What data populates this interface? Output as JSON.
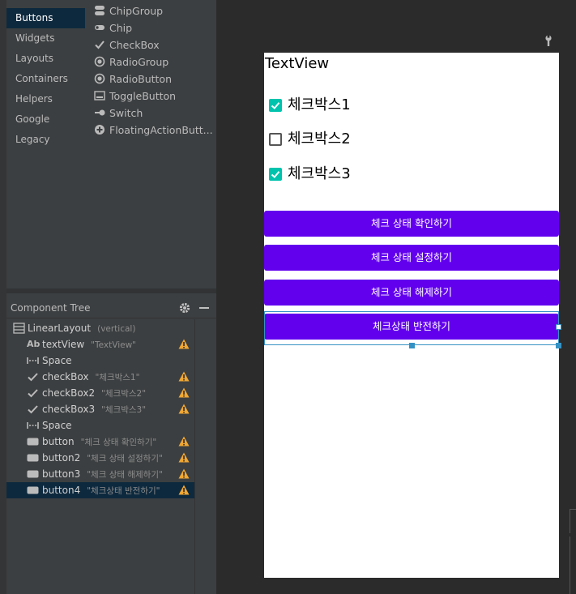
{
  "palette": {
    "categories": [
      "Buttons",
      "Widgets",
      "Layouts",
      "Containers",
      "Helpers",
      "Google",
      "Legacy"
    ],
    "selected_category": "Buttons",
    "items": [
      {
        "label": "ChipGroup",
        "icon": "chip-group-icon"
      },
      {
        "label": "Chip",
        "icon": "chip-icon"
      },
      {
        "label": "CheckBox",
        "icon": "checkmark-icon"
      },
      {
        "label": "RadioGroup",
        "icon": "radio-group-icon"
      },
      {
        "label": "RadioButton",
        "icon": "radio-button-icon"
      },
      {
        "label": "ToggleButton",
        "icon": "toggle-button-icon"
      },
      {
        "label": "Switch",
        "icon": "switch-icon"
      },
      {
        "label": "FloatingActionButt...",
        "icon": "fab-plus-icon"
      }
    ]
  },
  "component_tree": {
    "title": "Component Tree",
    "rows": [
      {
        "name": "LinearLayout",
        "detail": "(vertical)",
        "icon": "linear-layout-icon",
        "indent": 0,
        "warning": false
      },
      {
        "name": "textView",
        "detail": "\"TextView\"",
        "icon": "text-ab-icon",
        "indent": 1,
        "warning": true
      },
      {
        "name": "Space",
        "detail": "",
        "icon": "space-icon",
        "indent": 1,
        "warning": false
      },
      {
        "name": "checkBox",
        "detail": "\"체크박스1\"",
        "icon": "checkmark-icon",
        "indent": 1,
        "warning": true
      },
      {
        "name": "checkBox2",
        "detail": "\"체크박스2\"",
        "icon": "checkmark-icon",
        "indent": 1,
        "warning": true
      },
      {
        "name": "checkBox3",
        "detail": "\"체크박스3\"",
        "icon": "checkmark-icon",
        "indent": 1,
        "warning": true
      },
      {
        "name": "Space",
        "detail": "",
        "icon": "space-icon",
        "indent": 1,
        "warning": false
      },
      {
        "name": "button",
        "detail": "\"체크 상태 확인하기\"",
        "icon": "button-icon",
        "indent": 1,
        "warning": true
      },
      {
        "name": "button2",
        "detail": "\"체크 상태 설정하기\"",
        "icon": "button-icon",
        "indent": 1,
        "warning": true
      },
      {
        "name": "button3",
        "detail": "\"체크 상태 해제하기\"",
        "icon": "button-icon",
        "indent": 1,
        "warning": true
      },
      {
        "name": "button4",
        "detail": "\"체크상태 반전하기\"",
        "icon": "button-icon",
        "indent": 1,
        "warning": true,
        "selected": true
      }
    ]
  },
  "preview": {
    "text_view": "TextView",
    "checkboxes": [
      {
        "label": "체크박스1",
        "checked": true
      },
      {
        "label": "체크박스2",
        "checked": false
      },
      {
        "label": "체크박스3",
        "checked": true
      }
    ],
    "buttons": [
      "체크 상태 확인하기",
      "체크 상태 설정하기",
      "체크 상태 해제하기",
      "체크상태 반전하기"
    ]
  },
  "colors": {
    "accent_button": "#6200ee",
    "checkbox_checked": "#00c3ad",
    "selection_blue": "#3592c4",
    "warning": "#f0a732",
    "tree_selection": "#0d293e"
  }
}
